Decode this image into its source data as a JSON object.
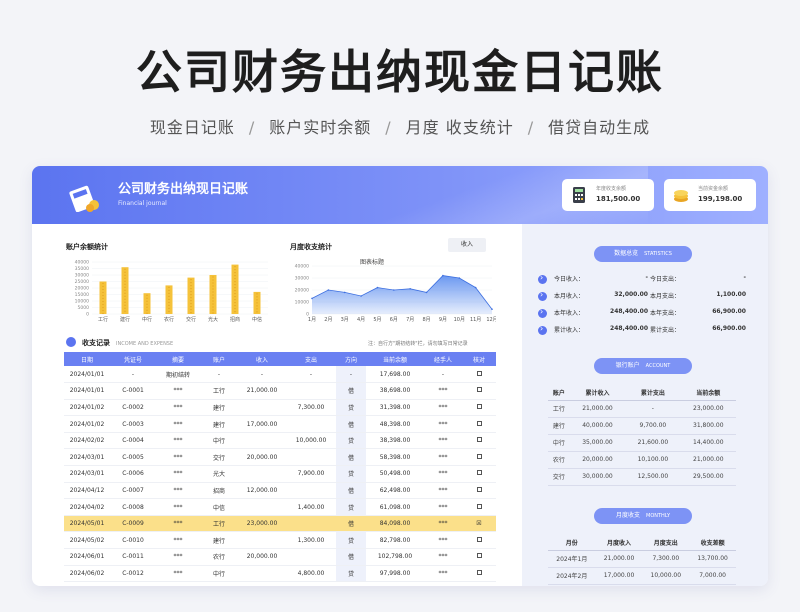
{
  "hero": {
    "title": "公司财务出纳现金日记账",
    "sub1": "现金日记账",
    "sub2": "账户实时余额",
    "sub3": "月度 收支统计",
    "sub4": "借贷自动生成",
    "sep": "/"
  },
  "app": {
    "title": "公司财务出纳现日记账",
    "subtitle": "Financial journal",
    "cards": [
      {
        "label": "年度收支余额",
        "value": "181,500.00",
        "icon": "calculator-icon"
      },
      {
        "label": "当前资金余额",
        "value": "199,198.00",
        "icon": "coins-icon"
      }
    ]
  },
  "charts": {
    "balance_label": "账户余额统计",
    "monthly_label": "月度收支统计",
    "income_button": "收入",
    "chart_title": "图表标题"
  },
  "chart_data": [
    {
      "type": "bar",
      "categories": [
        "工行",
        "建行",
        "中行",
        "农行",
        "交行",
        "光大",
        "招商",
        "中信"
      ],
      "values": [
        25000,
        36000,
        16000,
        22000,
        28000,
        30000,
        38000,
        17000
      ],
      "ylim": [
        0,
        40000
      ],
      "yticks": [
        "40000",
        "35000",
        "30000",
        "25000",
        "20000",
        "15000",
        "10000",
        "5000",
        "0"
      ],
      "color": "#f5c23a"
    },
    {
      "type": "area",
      "title": "图表标题",
      "categories": [
        "1月",
        "2月",
        "3月",
        "4月",
        "5月",
        "6月",
        "7月",
        "8月",
        "9月",
        "10月",
        "11月",
        "12月"
      ],
      "values": [
        13000,
        20000,
        18000,
        15000,
        22000,
        20000,
        21000,
        18000,
        32000,
        30000,
        22000,
        4000
      ],
      "ylim": [
        0,
        40000
      ],
      "yticks": [
        "40000",
        "30000",
        "20000",
        "10000",
        "0"
      ],
      "color": "#5b8def"
    }
  ],
  "ledger": {
    "title": "收支记录",
    "title_en": "INCOME AND EXPENSE",
    "note": "注：自行方\"期初结转\"栏，请勿填写日常记录",
    "columns": [
      "日期",
      "凭证号",
      "摘要",
      "账户",
      "收入",
      "支出",
      "方向",
      "当前余额",
      "经手人",
      "核对"
    ],
    "rows": [
      [
        "2024/01/01",
        "-",
        "期初结转",
        "-",
        "-",
        "-",
        "-",
        "17,698.00",
        "-",
        ""
      ],
      [
        "2024/01/01",
        "C-0001",
        "***",
        "工行",
        "21,000.00",
        "",
        "借",
        "38,698.00",
        "***",
        ""
      ],
      [
        "2024/01/02",
        "C-0002",
        "***",
        "建行",
        "",
        "7,300.00",
        "贷",
        "31,398.00",
        "***",
        ""
      ],
      [
        "2024/01/02",
        "C-0003",
        "***",
        "建行",
        "17,000.00",
        "",
        "借",
        "48,398.00",
        "***",
        ""
      ],
      [
        "2024/02/02",
        "C-0004",
        "***",
        "中行",
        "",
        "10,000.00",
        "贷",
        "38,398.00",
        "***",
        ""
      ],
      [
        "2024/03/01",
        "C-0005",
        "***",
        "交行",
        "20,000.00",
        "",
        "借",
        "58,398.00",
        "***",
        ""
      ],
      [
        "2024/03/01",
        "C-0006",
        "***",
        "光大",
        "",
        "7,900.00",
        "贷",
        "50,498.00",
        "***",
        ""
      ],
      [
        "2024/04/12",
        "C-0007",
        "***",
        "招商",
        "12,000.00",
        "",
        "借",
        "62,498.00",
        "***",
        ""
      ],
      [
        "2024/04/02",
        "C-0008",
        "***",
        "中信",
        "",
        "1,400.00",
        "贷",
        "61,098.00",
        "***",
        ""
      ],
      [
        "2024/05/01",
        "C-0009",
        "***",
        "工行",
        "23,000.00",
        "",
        "借",
        "84,098.00",
        "***",
        "☒"
      ],
      [
        "2024/05/02",
        "C-0010",
        "***",
        "建行",
        "",
        "1,300.00",
        "贷",
        "82,798.00",
        "***",
        ""
      ],
      [
        "2024/06/01",
        "C-0011",
        "***",
        "农行",
        "20,000.00",
        "",
        "借",
        "102,798.00",
        "***",
        ""
      ],
      [
        "2024/06/02",
        "C-0012",
        "***",
        "中行",
        "",
        "4,800.00",
        "贷",
        "97,998.00",
        "***",
        ""
      ]
    ]
  },
  "stats": {
    "pill": "数据总览",
    "pill_en": "STATISTICS",
    "rows": [
      [
        "今日收入：",
        "-",
        "今日支出：",
        "-"
      ],
      [
        "本月收入：",
        "32,000.00",
        "本月支出：",
        "1,100.00"
      ],
      [
        "本年收入：",
        "248,400.00",
        "本年支出：",
        "66,900.00"
      ],
      [
        "累计收入：",
        "248,400.00",
        "累计支出：",
        "66,900.00"
      ]
    ]
  },
  "accounts": {
    "pill": "银行账户",
    "pill_en": "ACCOUNT",
    "columns": [
      "账户",
      "累计收入",
      "累计支出",
      "当前余额"
    ],
    "rows": [
      [
        "工行",
        "21,000.00",
        "-",
        "23,000.00"
      ],
      [
        "建行",
        "40,000.00",
        "9,700.00",
        "31,800.00"
      ],
      [
        "中行",
        "35,000.00",
        "21,600.00",
        "14,400.00"
      ],
      [
        "农行",
        "20,000.00",
        "10,100.00",
        "21,000.00"
      ],
      [
        "交行",
        "30,000.00",
        "12,500.00",
        "29,500.00"
      ]
    ]
  },
  "monthly": {
    "pill": "月度收支",
    "pill_en": "MONTHLY",
    "columns": [
      "月份",
      "月度收入",
      "月度支出",
      "收支差额"
    ],
    "rows": [
      [
        "2024年1月",
        "21,000.00",
        "7,300.00",
        "13,700.00"
      ],
      [
        "2024年2月",
        "17,000.00",
        "10,000.00",
        "7,000.00"
      ]
    ]
  }
}
